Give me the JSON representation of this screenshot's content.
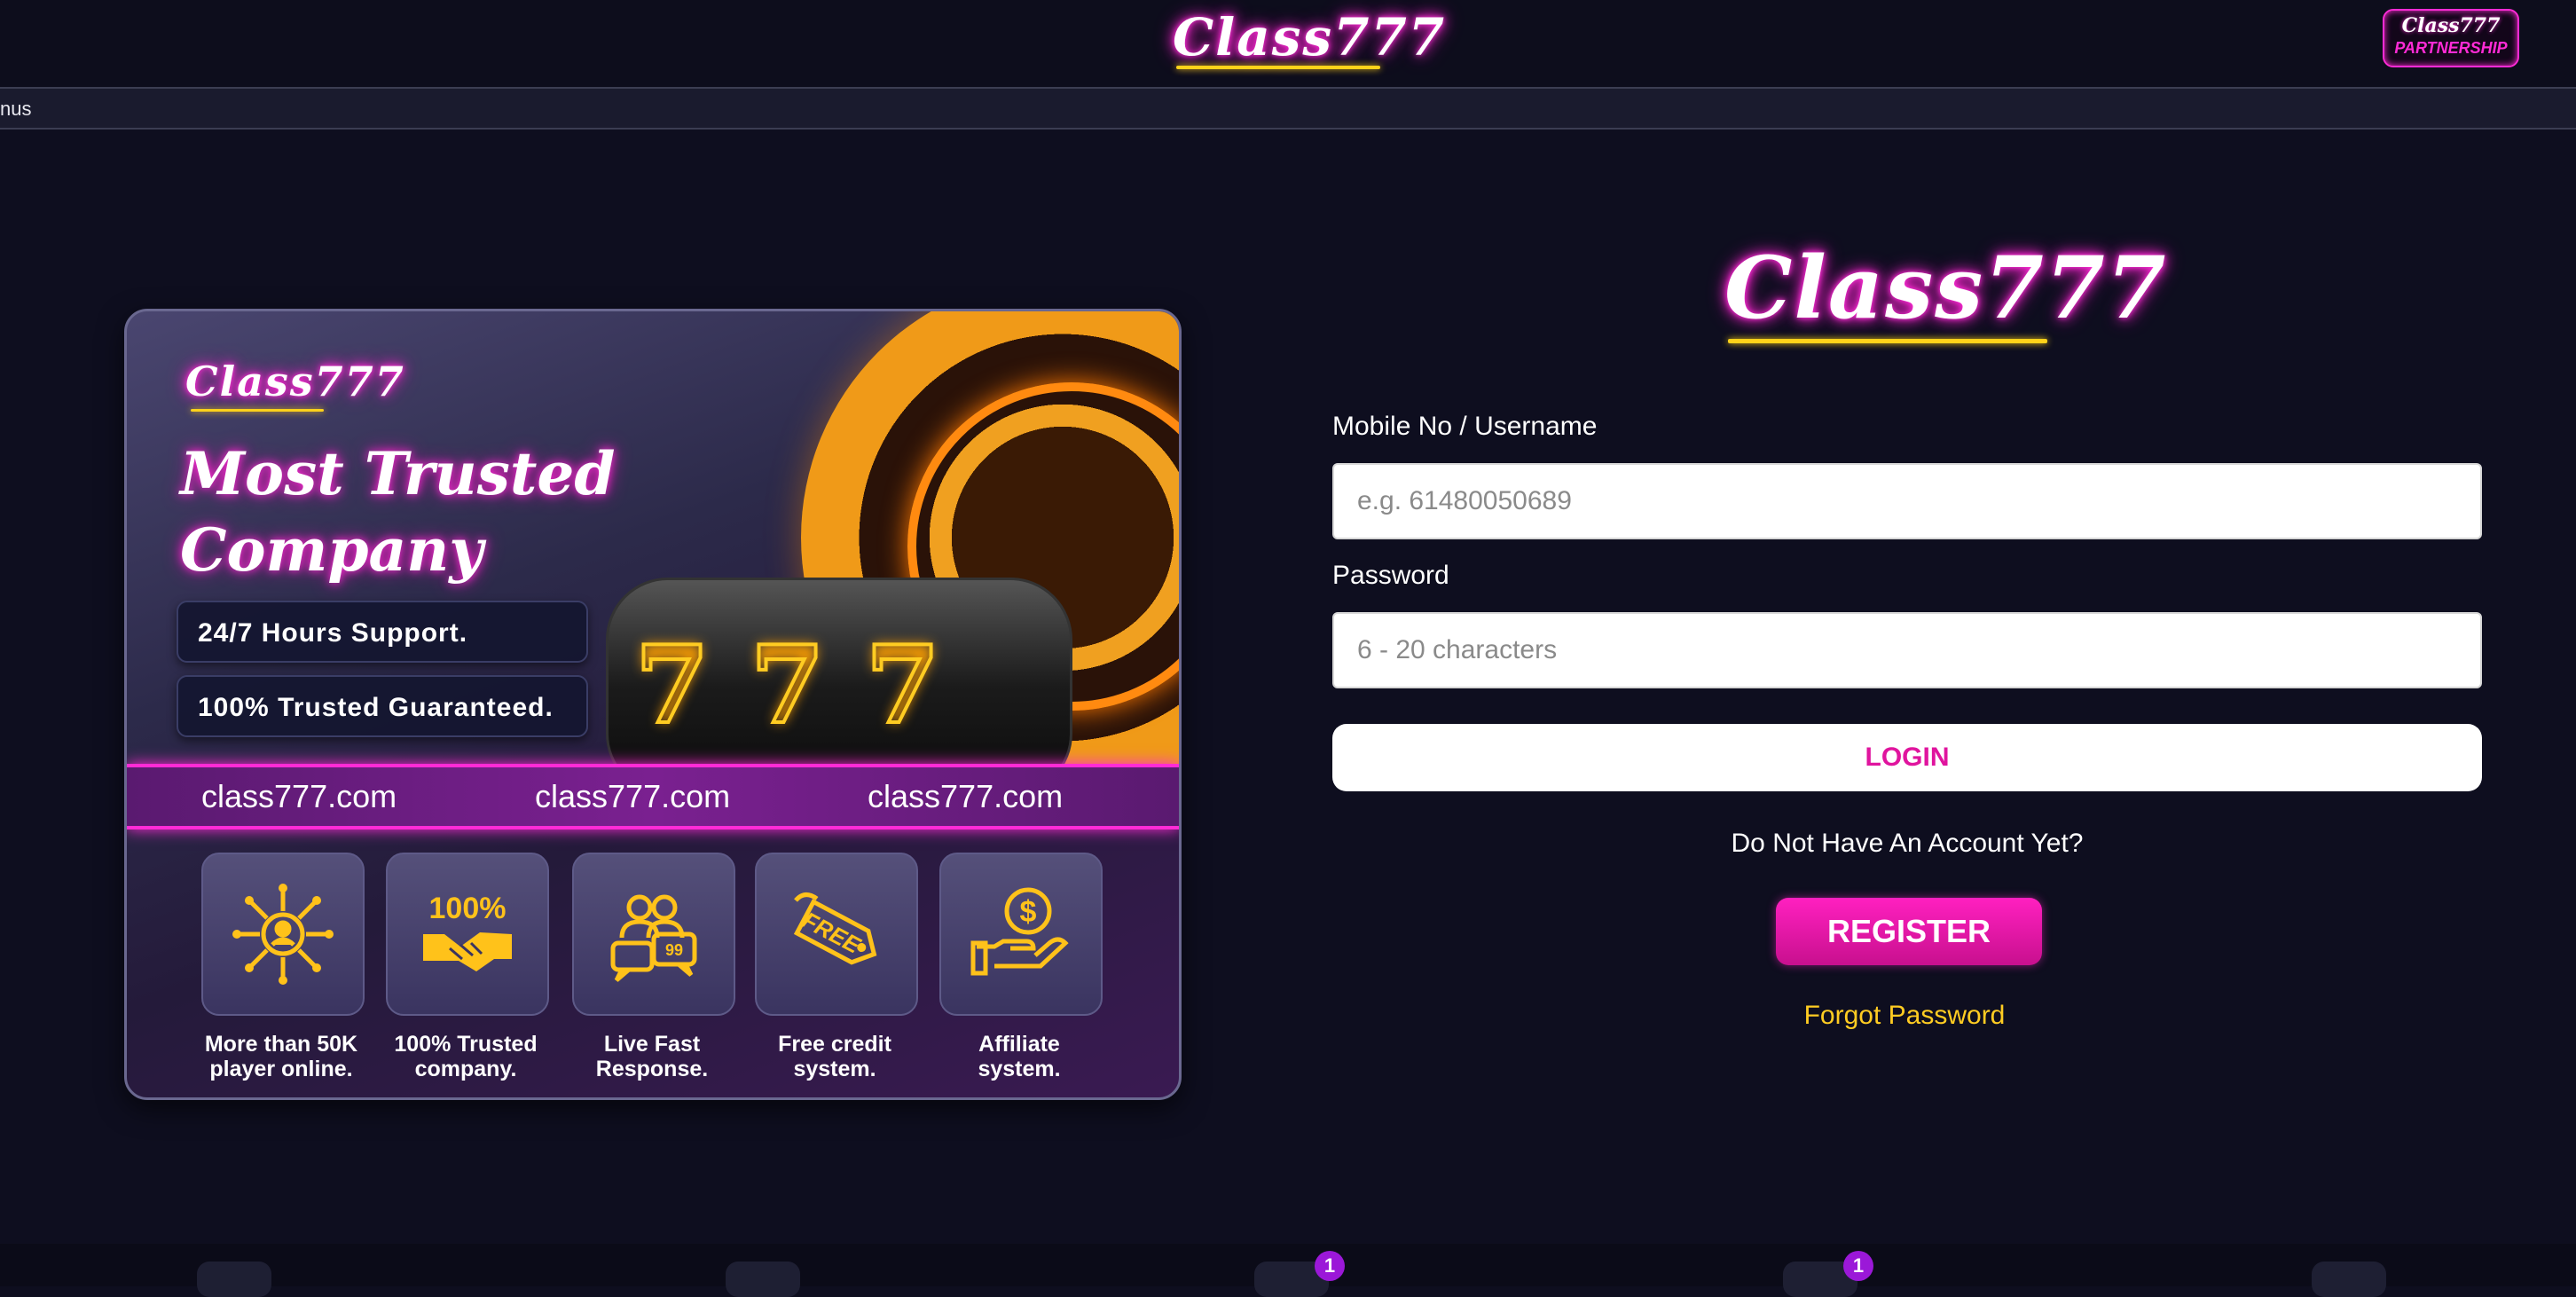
{
  "header": {
    "logo_text": "Class777",
    "partnership_logo": "Class777",
    "partnership_label": "PARTNERSHIP"
  },
  "marquee": {
    "text": "nus"
  },
  "banner": {
    "logo_text": "Class777",
    "title_line1": "Most Trusted",
    "title_line2": "Company",
    "pills": [
      "24/7 Hours Support.",
      "100% Trusted Guaranteed."
    ],
    "domains": [
      "class777.com",
      "class777.com",
      "class777.com"
    ],
    "reel_digits": [
      "7",
      "7",
      "7"
    ],
    "features": [
      {
        "icon": "network-users-icon",
        "line1": "More than 50K",
        "line2": "player online."
      },
      {
        "icon": "handshake-100-icon",
        "line1": "100% Trusted",
        "line2": "company.",
        "badge": "100%"
      },
      {
        "icon": "support-chat-icon",
        "line1": "Live Fast",
        "line2": "Response."
      },
      {
        "icon": "free-tag-icon",
        "line1": "Free credit",
        "line2": "system.",
        "tag": "FREE"
      },
      {
        "icon": "coin-hand-icon",
        "line1": "Affiliate",
        "line2": "system."
      }
    ]
  },
  "login": {
    "logo_text": "Class777",
    "username_label": "Mobile No / Username",
    "username_placeholder": "e.g. 61480050689",
    "password_label": "Password",
    "password_placeholder": "6 - 20 characters",
    "login_label": "LOGIN",
    "no_account_text": "Do Not Have An Account Yet?",
    "register_label": "REGISTER",
    "forgot_label": "Forgot Password"
  },
  "bottom_nav": {
    "badges": [
      "1",
      "1"
    ]
  },
  "colors": {
    "background": "#0e0e1f",
    "accent_pink": "#ff2bd6",
    "accent_yellow": "#ffcc22",
    "register_pink": "#e0149e"
  }
}
